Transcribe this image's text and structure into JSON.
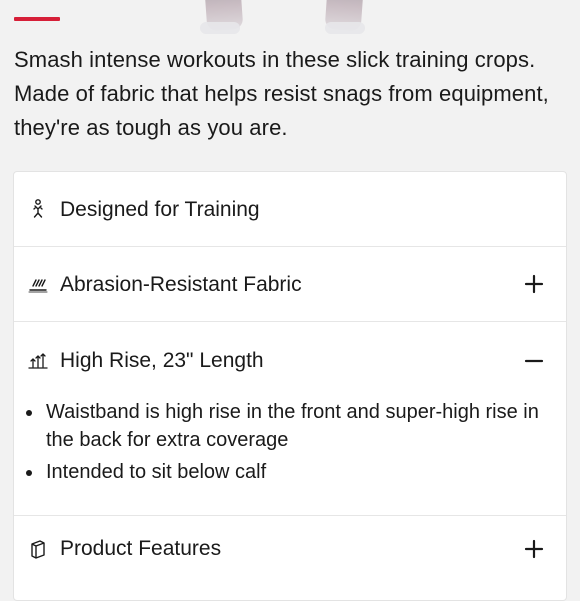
{
  "description": {
    "text": "Smash intense workouts in these slick training crops. Made of fabric that helps resist snags from equipment, they're as tough as you are."
  },
  "features": {
    "items": [
      {
        "label": "Designed for Training",
        "icon": "runner-icon",
        "toggle": "none"
      },
      {
        "label": "Abrasion-Resistant Fabric",
        "icon": "abrasion-icon",
        "toggle": "plus-icon"
      },
      {
        "label": "High Rise, 23\" Length",
        "icon": "height-icon",
        "toggle": "minus-icon",
        "expanded": true,
        "details": [
          "Waistband is high rise in the front and super-high rise in the back for extra coverage",
          "Intended to sit below calf"
        ]
      },
      {
        "label": "Product Features",
        "icon": "box-icon",
        "toggle": "plus-icon"
      }
    ]
  },
  "colors": {
    "accent": "#d61f38",
    "background": "#f2f2f2",
    "panel": "#ffffff",
    "divider": "#e6e6e6",
    "text": "#1a1a1a"
  }
}
